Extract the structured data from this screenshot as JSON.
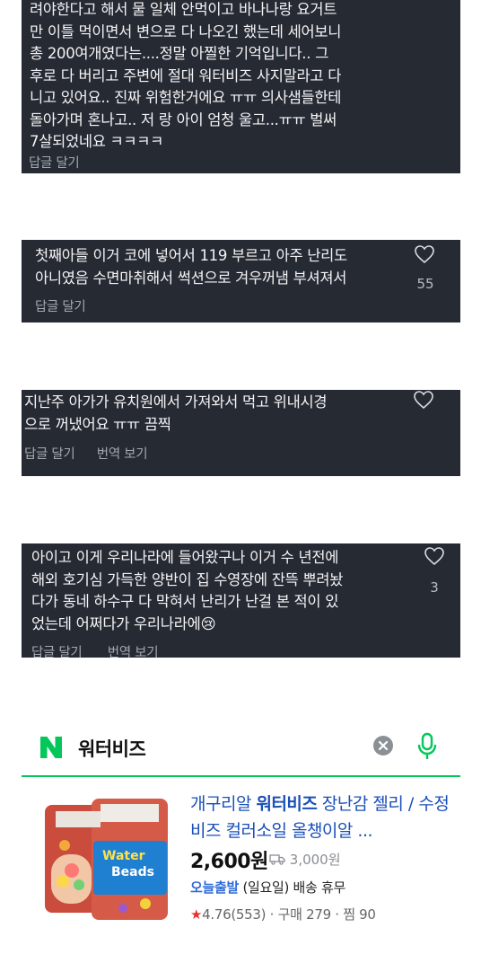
{
  "comments": [
    {
      "text": "려야한다고 해서 물 일체 안먹이고 바나나랑 요거트\n만 이틀 먹이면서  변으로 다 나오긴 했는데 세어보니\n총 200여개였다는....정말 아찔한 기억입니다.. 그\n후로 다 버리고 주변에 절대 워터비즈 사지말라고 다\n니고 있어요.. 진짜 위험한거에요 ㅠㅠ 의사샘들한테\n돌아가며 혼나고.. 저 랑 아이 엄청 울고...ㅠㅠ 벌써\n7살되었네요 ㅋㅋㅋㅋ",
      "reply_label": "답글 달기"
    },
    {
      "text": "첫째아들 이거 코에 넣어서 119 부르고 아주 난리도\n아니였음 수면마취해서 썩션으로 겨우꺼냄 부셔져서",
      "reply_label": "답글 달기",
      "likes": "55"
    },
    {
      "text": "지난주 아가가 유치원에서 가져와서 먹고 위내시경\n으로 꺼냈어요 ㅠㅠ 끔찍",
      "reply_label": "답글 달기",
      "translate_label": "번역 보기"
    },
    {
      "text": "아이고 이게 우리나라에 들어왔구나 이거 수 년전에\n해외 호기심 가득한 양반이 집 수영장에 잔뜩 뿌려놨\n다가 동네 하수구 다 막혀서 난리가 난걸 본 적이 있\n었는데 어쩌다가 우리나라에😢",
      "reply_label": "답글 달기",
      "translate_label": "번역 보기",
      "likes": "3"
    }
  ],
  "search": {
    "logo": "N",
    "query": "워터비즈",
    "brand_color": "#03c75a"
  },
  "product": {
    "title_prefix": "개구리알 ",
    "title_highlight": "워터비즈",
    "title_rest": " 장난감 젤리 / 수정비즈 컬러소일 올챙이알 ...",
    "price": "2,600원",
    "original_price": "3,000원",
    "delivery_tag": "오늘출발",
    "delivery_text": " (일요일) 배송 휴무",
    "rating": "4.76",
    "review_count": "(553)",
    "purchases": "구매 279",
    "wishes": "찜 90",
    "image_label_1": "Water",
    "image_label_2": "Beads"
  }
}
